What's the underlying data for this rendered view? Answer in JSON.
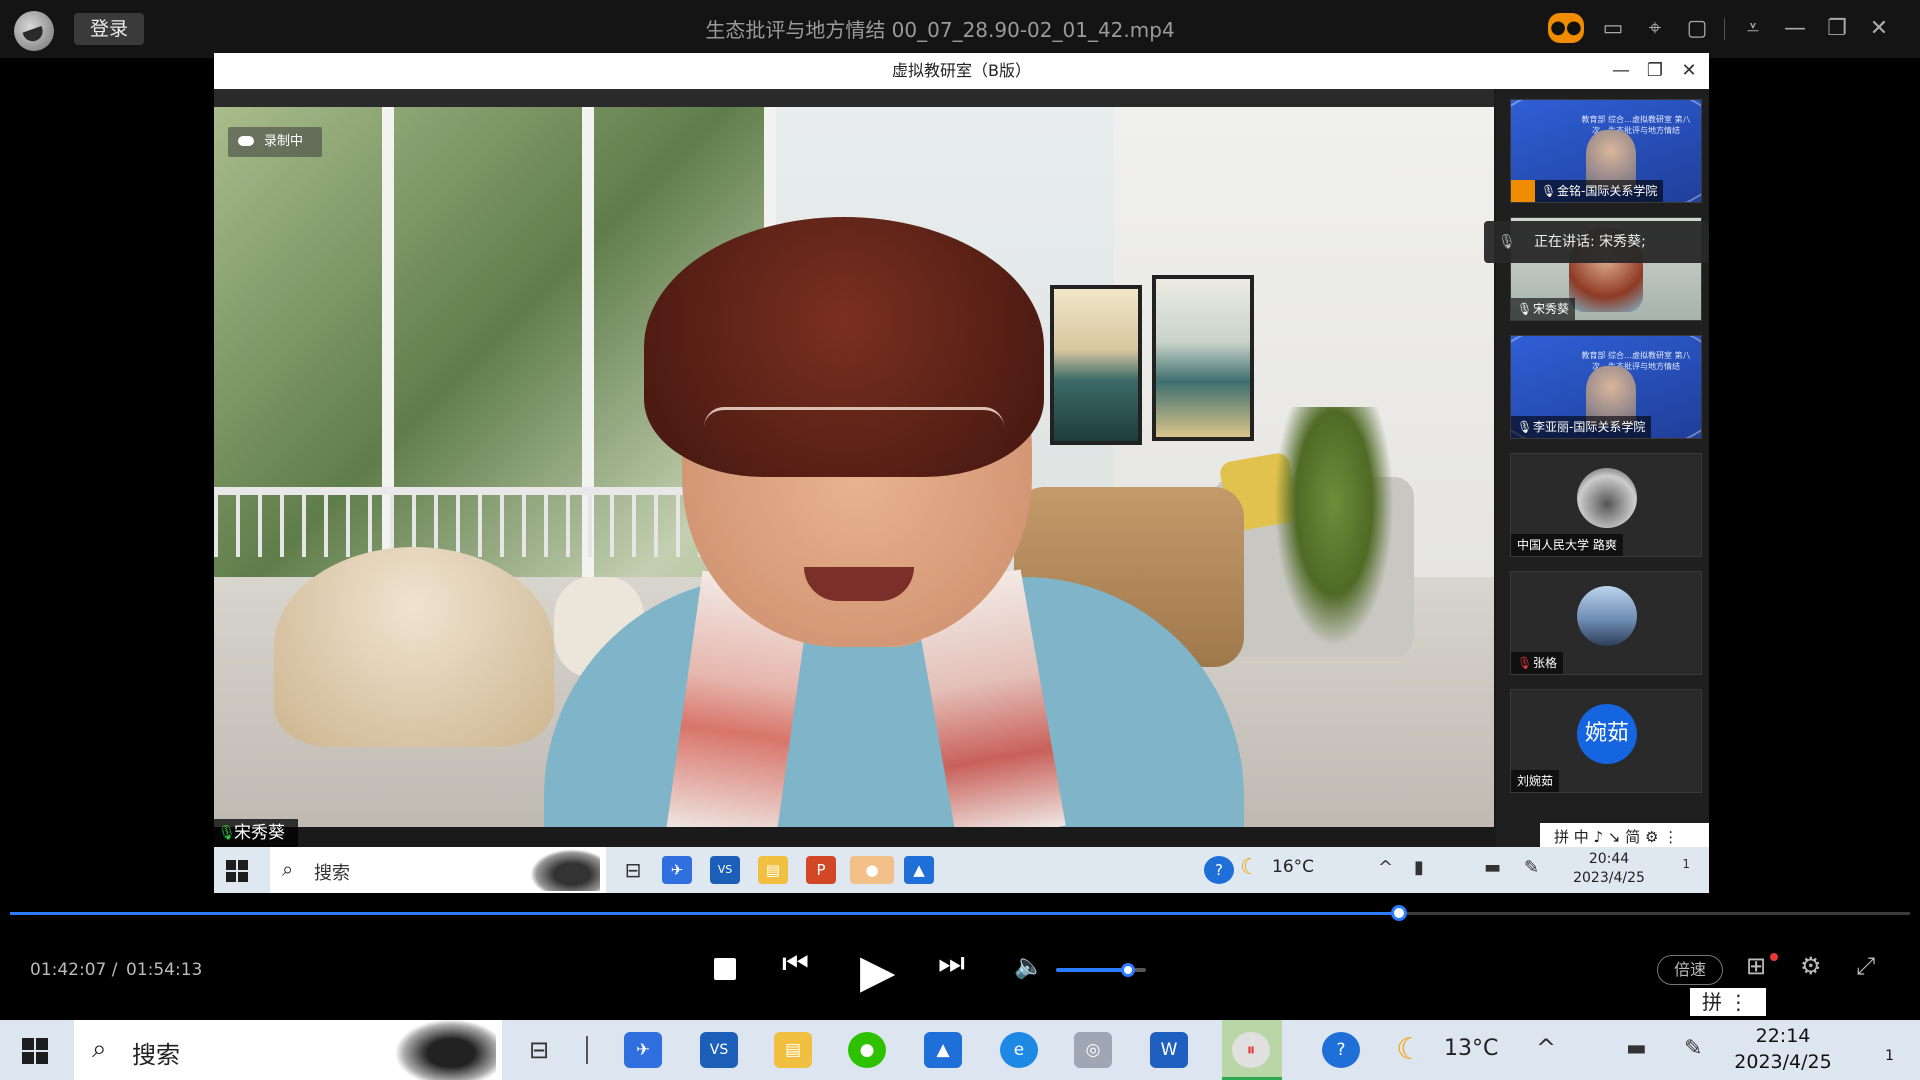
{
  "player": {
    "login_label": "登录",
    "file_title": "生态批评与地方情结 00_07_28.90-02_01_42.mp4",
    "icons": [
      "gamepad-icon",
      "layout-icon",
      "pin-icon",
      "folder-icon",
      "menu-icon",
      "minimize-icon",
      "restore-icon",
      "close-icon"
    ]
  },
  "meeting": {
    "window_title": "虚拟教研室（B版）",
    "recording_label": "录制中",
    "active_speaker": "宋秀葵",
    "speaking_now": "正在讲话: 宋秀葵;",
    "participants": [
      {
        "name": "金铭-国际关系学院",
        "type": "slide",
        "slide_text": "教育部 综合…虚拟教研室 第八次…生态批评与地方情结"
      },
      {
        "name": "宋秀葵",
        "type": "video"
      },
      {
        "name": "李亚丽-国际关系学院",
        "type": "slide",
        "slide_text": "教育部 综合…虚拟教研室 第八次…生态批评与地方情结"
      },
      {
        "name": "中国人民大学 路爽",
        "type": "avatar"
      },
      {
        "name": "张格",
        "type": "avatar"
      },
      {
        "name": "刘婉茹",
        "type": "avatar",
        "avatar_text": "婉茹"
      }
    ],
    "inner_ime": "拼 中 ♪ ↘ 简 ⚙ ⋮",
    "inner_taskbar": {
      "search_placeholder": "搜索",
      "weather": "16°C",
      "time": "20:44",
      "date": "2023/4/25",
      "notifications": "1"
    }
  },
  "playback": {
    "current_time": "01:42:07 /",
    "total_time": "01:54:13",
    "progress": 0.731,
    "volume": 0.8,
    "speed_label": "倍速",
    "ime": "拼 ⋮"
  },
  "taskbar": {
    "search_placeholder": "搜索",
    "weather": "13°C",
    "time": "22:14",
    "date": "2023/4/25",
    "notifications": "1"
  },
  "colors": {
    "accent": "#2b7cff",
    "title_bg": "#141414",
    "game_icon": "#f08c00"
  }
}
